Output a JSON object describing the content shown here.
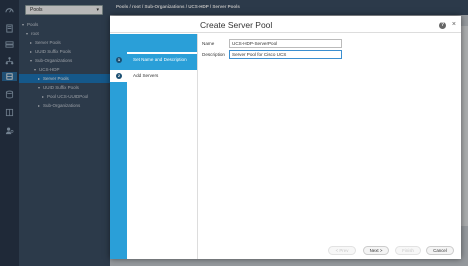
{
  "nav": {
    "filter_value": "Pools",
    "tree": [
      {
        "label": "Pools",
        "level": 0,
        "expanded": true
      },
      {
        "label": "root",
        "level": 1,
        "expanded": true
      },
      {
        "label": "Server Pools",
        "level": 2,
        "expanded": false
      },
      {
        "label": "UUID Suffix Pools",
        "level": 2,
        "expanded": false
      },
      {
        "label": "Sub-Organizations",
        "level": 2,
        "expanded": true
      },
      {
        "label": "UCS-HDP",
        "level": 3,
        "expanded": true
      },
      {
        "label": "Server Pools",
        "level": 4,
        "expanded": false,
        "selected": true
      },
      {
        "label": "UUID Suffix Pools",
        "level": 4,
        "expanded": true
      },
      {
        "label": "Pool UCS-UUIDPool",
        "level": 5,
        "expanded": false
      },
      {
        "label": "Sub-Organizations",
        "level": 4,
        "expanded": false
      }
    ]
  },
  "breadcrumb": "Pools / root / Sub-Organizations / UCS-HDP / Server Pools",
  "dialog": {
    "title": "Create Server Pool",
    "help_label": "?",
    "close_label": "×",
    "steps": [
      {
        "num": "1",
        "label": "Set Name and Description"
      },
      {
        "num": "2",
        "label": "Add Servers"
      }
    ],
    "form": {
      "name_label": "Name",
      "name_value": "UCS-HDP-ServerPool",
      "description_label": "Description",
      "description_value": "Server Pool for Cisco UCS"
    },
    "buttons": {
      "prev": "< Prev",
      "next": "Next >",
      "finish": "Finish",
      "cancel": "Cancel"
    }
  },
  "colors": {
    "accent": "#2a9fd8",
    "nav_bg": "#3e5167",
    "rail_bg": "#2b3a4e",
    "selected": "#1e7bc0"
  }
}
